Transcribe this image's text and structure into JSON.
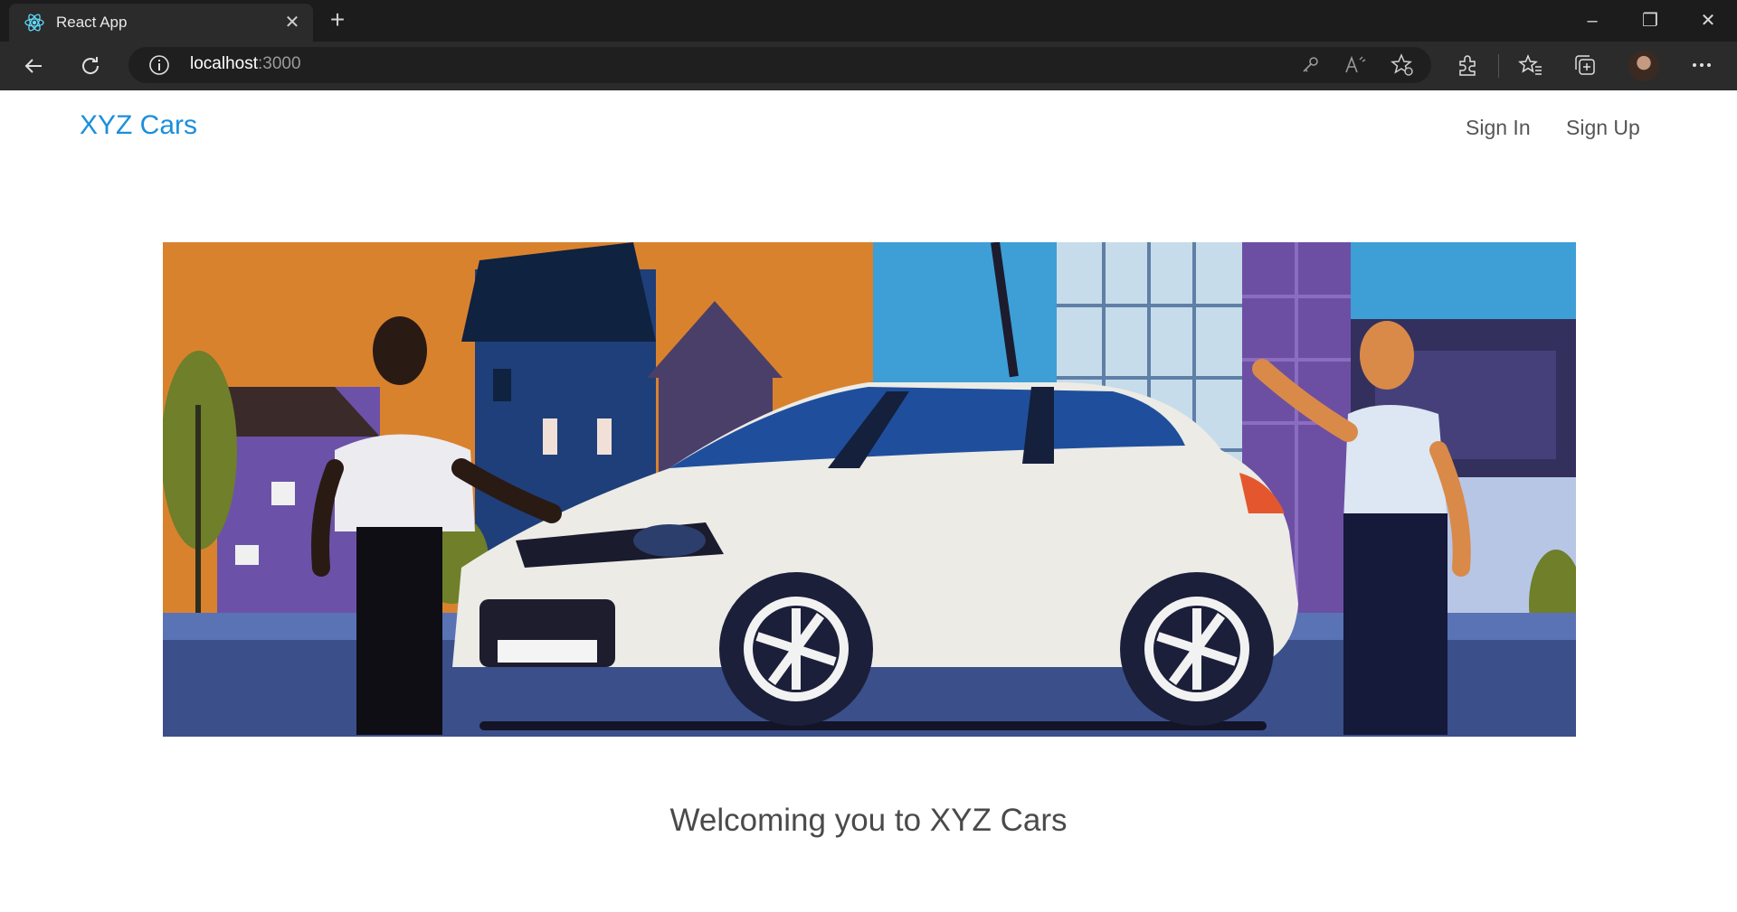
{
  "browser": {
    "tab_title": "React App",
    "url_host": "localhost",
    "url_port": ":3000",
    "icons": [
      "react-favicon",
      "close-icon",
      "plus-icon",
      "minimize-icon",
      "restore-icon",
      "window-close-icon",
      "back-arrow-icon",
      "refresh-icon",
      "info-icon",
      "key-icon",
      "read-aloud-icon",
      "favorite-add-icon",
      "extensions-icon",
      "favorites-icon",
      "collections-icon",
      "profile-avatar",
      "more-icon"
    ]
  },
  "navbar": {
    "brand": "XYZ Cars",
    "links": [
      "Sign In",
      "Sign Up"
    ],
    "brand_color": "#1a8fdb"
  },
  "hero": {
    "image_alt": "Illustration of two salesmen presenting a white car"
  },
  "welcome": {
    "text": "Welcoming you to XYZ Cars"
  }
}
